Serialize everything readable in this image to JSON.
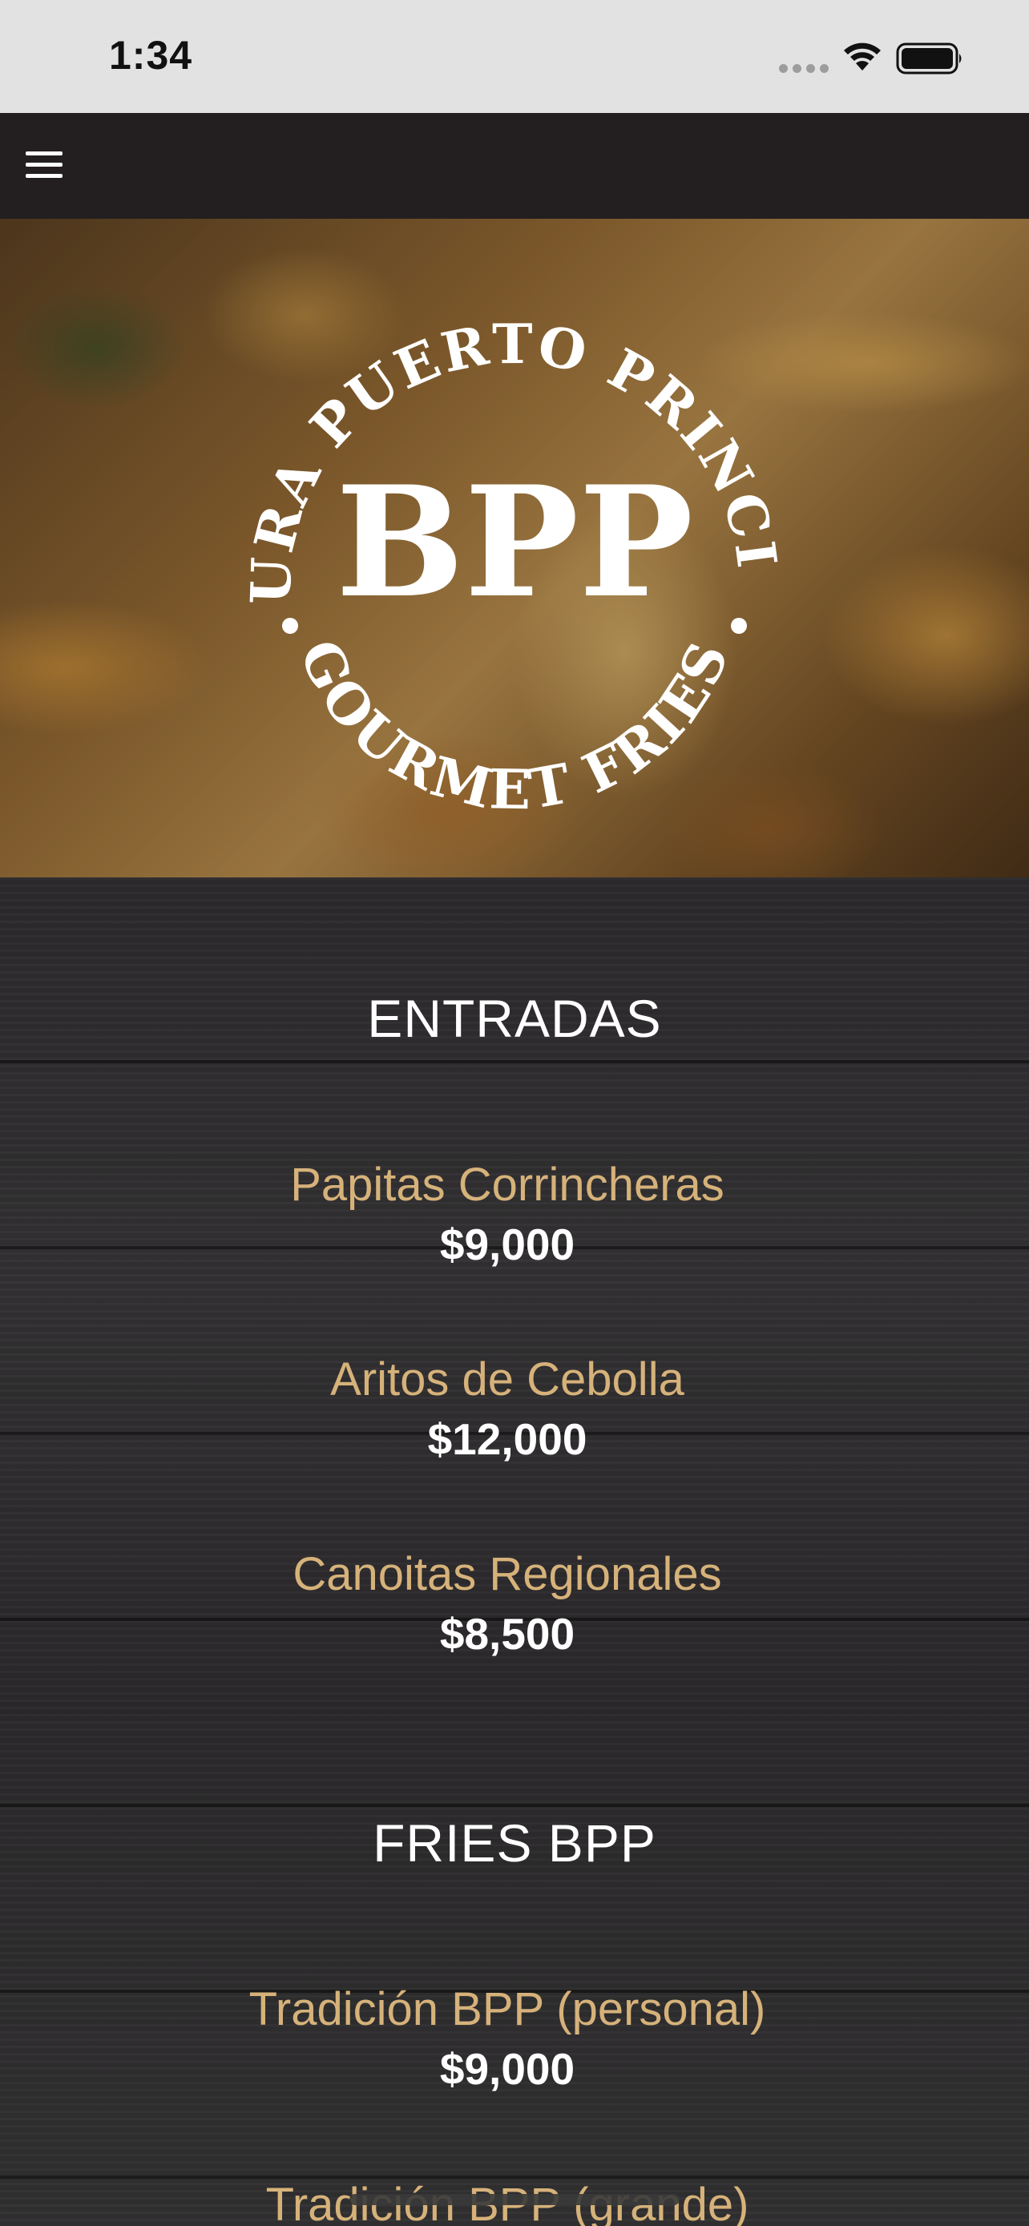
{
  "status_bar": {
    "time": "1:34"
  },
  "nav": {
    "menu_icon": "hamburger-menu-icon"
  },
  "hero": {
    "logo_top_arc": "BTURA PUERTO PRINCIPAL",
    "logo_bottom_arc": "GOURMET FRIES",
    "logo_mark": "BPP"
  },
  "menu": {
    "sections": [
      {
        "title": "ENTRADAS",
        "items": [
          {
            "name": "Papitas Corrincheras",
            "price": "$9,000"
          },
          {
            "name": "Aritos de Cebolla",
            "price": "$12,000"
          },
          {
            "name": "Canoitas Regionales",
            "price": "$8,500"
          }
        ]
      },
      {
        "title": "FRIES BPP",
        "items": [
          {
            "name": "Tradición BPP (personal)",
            "price": "$9,000"
          },
          {
            "name": "Tradición BPP (grande)",
            "price": ""
          }
        ]
      }
    ]
  },
  "colors": {
    "item_name": "#d6b27a",
    "nav_bg": "#231f20",
    "status_bg": "#e2e2e2"
  }
}
